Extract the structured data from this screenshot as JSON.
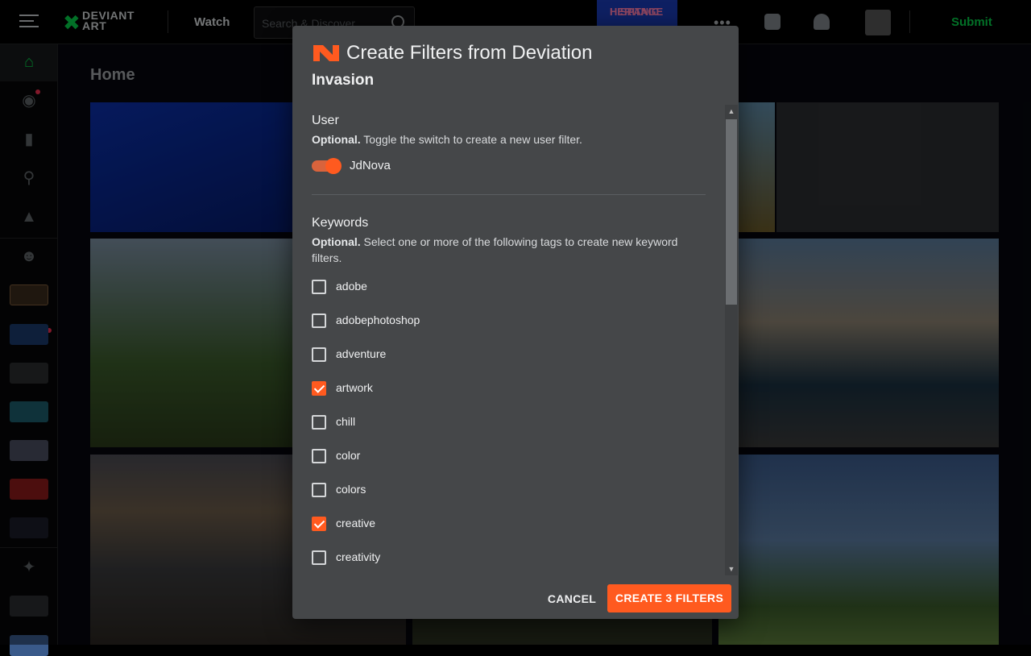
{
  "topbar": {
    "logo_line1": "DEVIANT",
    "logo_line2": "ART",
    "watch_label": "Watch",
    "search_placeholder": "Search & Discover",
    "promo_line1": "HISPANIC",
    "promo_line2": "HERITAGE",
    "more_label": "•••",
    "submit_label": "Submit"
  },
  "main": {
    "page_title": "Home"
  },
  "modal": {
    "title": "Create Filters from Deviation",
    "subtitle": "Invasion",
    "user_section": {
      "title": "User",
      "hint_bold": "Optional.",
      "hint_text": " Toggle the switch to create a new user filter.",
      "toggle_on": true,
      "username": "JdNova"
    },
    "keyword_section": {
      "title": "Keywords",
      "hint_bold": "Optional.",
      "hint_text": " Select one or more of the following tags to create new keyword filters."
    },
    "keywords": [
      {
        "label": "adobe",
        "checked": false
      },
      {
        "label": "adobephotoshop",
        "checked": false
      },
      {
        "label": "adventure",
        "checked": false
      },
      {
        "label": "artwork",
        "checked": true
      },
      {
        "label": "chill",
        "checked": false
      },
      {
        "label": "color",
        "checked": false
      },
      {
        "label": "colors",
        "checked": false
      },
      {
        "label": "creative",
        "checked": true
      },
      {
        "label": "creativity",
        "checked": false
      }
    ],
    "cancel_label": "CANCEL",
    "create_label": "CREATE 3 FILTERS"
  },
  "colors": {
    "accent": "#ff5a1f",
    "brand_green": "#05cc47",
    "modal_bg": "#454749"
  }
}
